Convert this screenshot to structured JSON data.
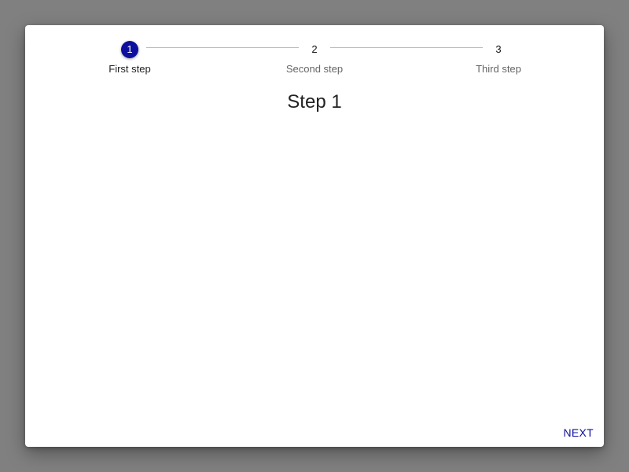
{
  "stepper": {
    "steps": [
      {
        "number": "1",
        "label": "First step",
        "active": true
      },
      {
        "number": "2",
        "label": "Second step",
        "active": false
      },
      {
        "number": "3",
        "label": "Third step",
        "active": false
      }
    ]
  },
  "content": {
    "title": "Step 1"
  },
  "actions": {
    "next_label": "NEXT"
  },
  "colors": {
    "accent": "#0d0f9e",
    "backdrop": "#808080",
    "surface": "#ffffff"
  }
}
